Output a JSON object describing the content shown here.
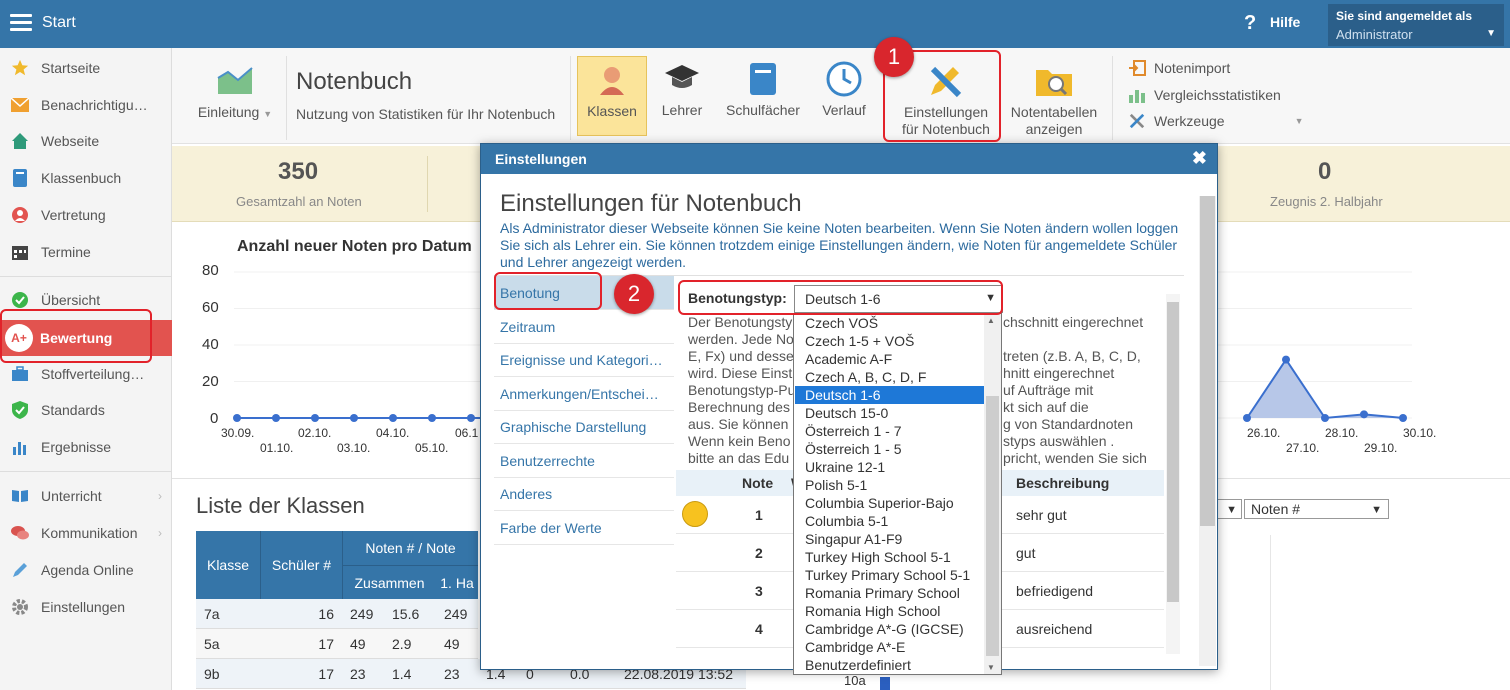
{
  "topbar": {
    "title": "Start",
    "help_label": "Hilfe",
    "login_line1": "Sie sind angemeldet als",
    "login_line2": "Administrator"
  },
  "sidebar": {
    "items": [
      {
        "label": "Startseite",
        "icon": "star-icon"
      },
      {
        "label": "Benachrichtigu…",
        "icon": "envelope-icon"
      },
      {
        "label": "Webseite",
        "icon": "home-icon"
      },
      {
        "label": "Klassenbuch",
        "icon": "book-icon"
      },
      {
        "label": "Vertretung",
        "icon": "person-icon"
      },
      {
        "label": "Termine",
        "icon": "calendar-icon"
      },
      {
        "label": "Übersicht",
        "icon": "check-circle-icon"
      },
      {
        "label": "Bewertung",
        "icon": "grade-a-plus-icon"
      },
      {
        "label": "Stoffverteilung…",
        "icon": "briefcase-icon"
      },
      {
        "label": "Standards",
        "icon": "shield-check-icon"
      },
      {
        "label": "Ergebnisse",
        "icon": "bar-chart-icon"
      },
      {
        "label": "Unterricht",
        "icon": "open-book-icon"
      },
      {
        "label": "Kommunikation",
        "icon": "chat-icon"
      },
      {
        "label": "Agenda Online",
        "icon": "pencil-icon"
      },
      {
        "label": "Einstellungen",
        "icon": "gear-icon"
      }
    ]
  },
  "toolbar": {
    "intro_label": "Einleitung",
    "title": "Notenbuch",
    "subtitle": "Nutzung von Statistiken für Ihr Notenbuch",
    "btn_klassen": "Klassen",
    "btn_lehrer": "Lehrer",
    "btn_schulfaecher": "Schulfächer",
    "btn_verlauf": "Verlauf",
    "btn_einst_1": "Einstellungen",
    "btn_einst_2": "für Notenbuch",
    "btn_notentab_1": "Notentabellen",
    "btn_notentab_2": "anzeigen",
    "link_import": "Notenimport",
    "link_vergleich": "Vergleichsstatistiken",
    "link_werkzeuge": "Werkzeuge"
  },
  "stats": {
    "total_num": "350",
    "total_label": "Gesamtzahl an Noten",
    "zeugnis_num": "0",
    "zeugnis_label": "Zeugnis 2. Halbjahr"
  },
  "chart_data": {
    "type": "line",
    "title": "Anzahl neuer Noten pro Datum",
    "ylim": [
      0,
      80
    ],
    "yticks": [
      "80",
      "60",
      "40",
      "20",
      "0"
    ],
    "x_upper": [
      "30.09.",
      "02.10.",
      "04.10.",
      "06.1"
    ],
    "x_lower": [
      "01.10.",
      "03.10.",
      "05.10."
    ],
    "x_upper_right": [
      "26.10.",
      "28.10.",
      "30.10."
    ],
    "x_lower_right": [
      "27.10.",
      "29.10."
    ],
    "left_values": [
      0,
      0,
      0,
      0,
      0,
      0,
      0,
      0,
      0,
      0,
      0,
      0,
      0
    ],
    "right_values": [
      0,
      32,
      0,
      2,
      0
    ]
  },
  "list": {
    "title": "Liste der Klassen",
    "headers": {
      "klasse": "Klasse",
      "schueler": "Schüler #",
      "noten": "Noten # / Note",
      "zusammen": "Zusammen",
      "halbjahr": "1. Ha"
    },
    "rows": [
      {
        "klasse": "7a",
        "schueler": "16",
        "noten": "249",
        "avg": "15.6",
        "h1": "249"
      },
      {
        "klasse": "5a",
        "schueler": "17",
        "noten": "49",
        "avg": "2.9",
        "h1": "49"
      },
      {
        "klasse": "9b",
        "schueler": "17",
        "noten": "23",
        "avg": "1.4",
        "h1": "23"
      }
    ],
    "row_partial": {
      "a": "1.4",
      "b": "0",
      "c": "0.0",
      "date": "22.08.2019 13:52",
      "cls": "10a"
    },
    "filter_noten": "Noten #"
  },
  "modal": {
    "header": "Einstellungen",
    "title": "Einstellungen für Notenbuch",
    "description": "Als Administrator dieser Webseite können Sie keine Noten bearbeiten. Wenn Sie Noten ändern wollen loggen Sie sich als Lehrer ein. Sie können trotzdem einige Einstellungen ändern, wie Noten für angemeldete Schüler und Lehrer angezeigt werden.",
    "nav": [
      "Benotung",
      "Zeitraum",
      "Ereignisse und Kategori…",
      "Anmerkungen/Entschei…",
      "Graphische Darstellung",
      "Benutzerrechte",
      "Anderes",
      "Farbe der Werte"
    ],
    "benotungstyp_label": "Benotungstyp:",
    "benotungstyp_value": "Deutsch 1-6",
    "body_lines": [
      "Der Benotungsty",
      "werden. Jede No",
      "E, Fx) und desse",
      "wird. Diese Einst",
      "Benotungstyp-Pu",
      "Berechnung des",
      "aus. Sie können",
      "Wenn kein Beno",
      "bitte an das Edu"
    ],
    "body_right": [
      "chschnitt eingerechnet",
      "treten (z.B. A, B, C, D,",
      "hnitt eingerechnet",
      "uf Aufträge mit",
      "kt sich auf die",
      "g von Standardnoten",
      "styps auswählen .",
      "pricht, wenden Sie sich"
    ],
    "grade_table": {
      "head_note": "Note",
      "head_w": "W",
      "head_desc": "Beschreibung",
      "rows": [
        {
          "note": "1",
          "desc": "sehr gut"
        },
        {
          "note": "2",
          "desc": "gut"
        },
        {
          "note": "3",
          "desc": "befriedigend"
        },
        {
          "note": "4",
          "desc": "ausreichend"
        }
      ]
    },
    "dropdown_options": [
      "Czech VOŠ",
      "Czech 1-5 + VOŠ",
      "Academic A-F",
      "Czech A, B, C, D, F",
      "Deutsch 1-6",
      "Deutsch 15-0",
      "Österreich 1 - 7",
      "Österreich 1 - 5",
      "Ukraine 12-1",
      "Polish 5-1",
      "Columbia Superior-Bajo",
      "Columbia 5-1",
      "Singapur A1-F9",
      "Turkey High School 5-1",
      "Turkey Primary School 5-1",
      "Romania Primary School",
      "Romania High School",
      "Cambridge A*-G (IGCSE)",
      "Cambridge A*-E",
      "Benutzerdefiniert"
    ],
    "dropdown_selected_index": 4
  },
  "callouts": {
    "one": "1",
    "two": "2"
  },
  "colors": {
    "accent": "#3575a8",
    "active": "#e2534f",
    "callout": "#e2222a",
    "selection": "#1e78d7"
  }
}
